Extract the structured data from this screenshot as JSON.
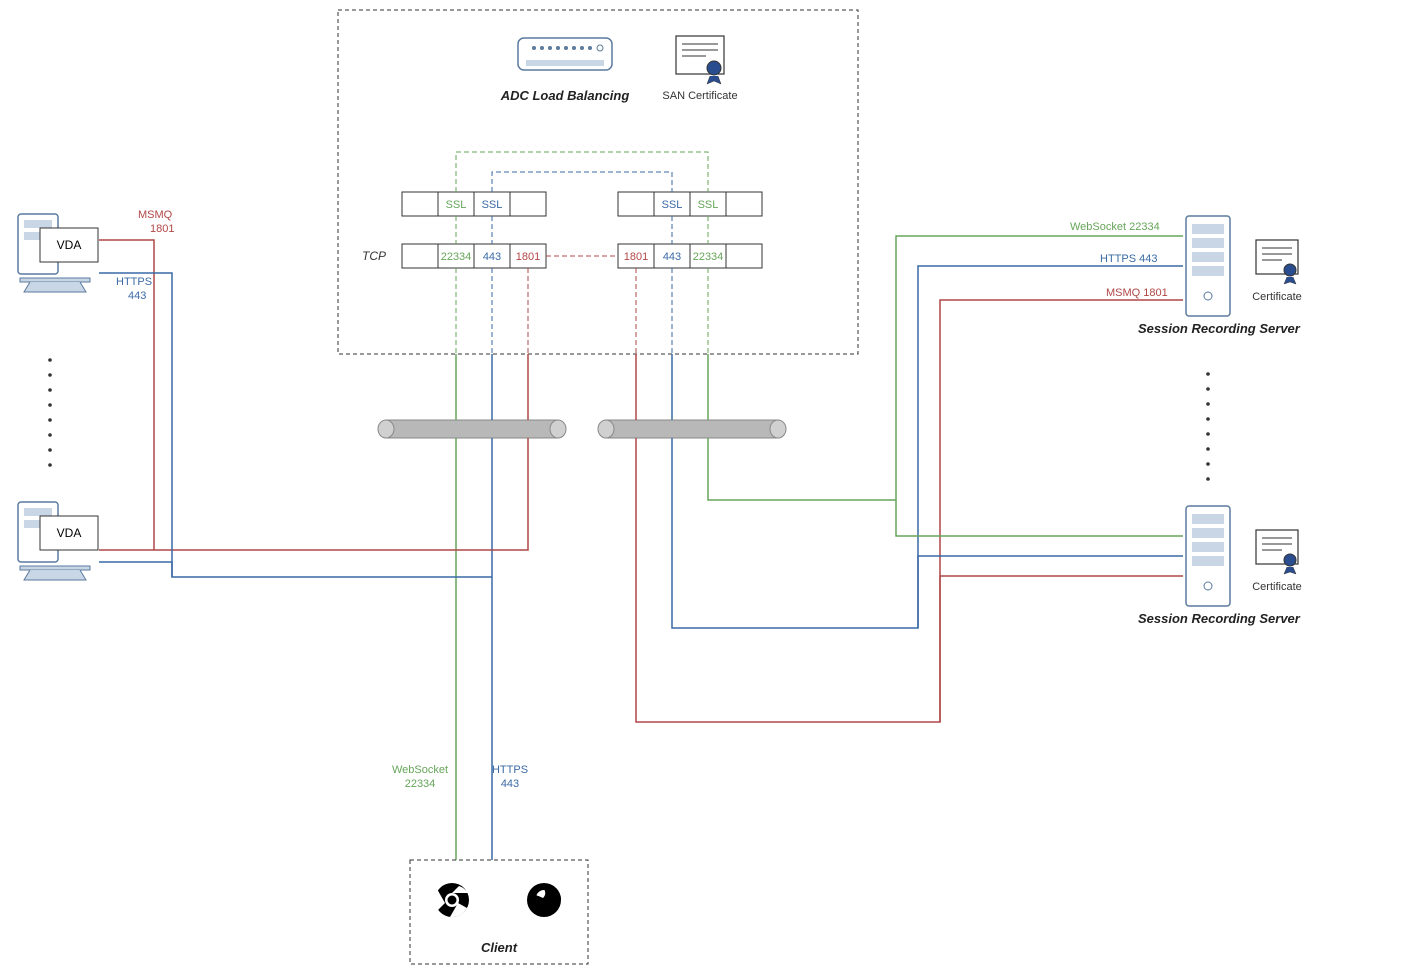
{
  "adc": {
    "title": "ADC Load Balancing",
    "san_cert": "SAN Certificate",
    "row1_label": "",
    "row2_label": "TCP",
    "boxes_row1": {
      "l": [
        "",
        "SSL",
        "SSL",
        ""
      ],
      "r": [
        "",
        "SSL",
        "SSL",
        ""
      ]
    },
    "boxes_row2": {
      "l": [
        "",
        "22334",
        "443",
        "1801"
      ],
      "r": [
        "1801",
        "443",
        "22334",
        ""
      ]
    }
  },
  "left": {
    "vda": "VDA",
    "msmq": "MSMQ",
    "msmq_port": "1801",
    "https": "HTTPS",
    "https_port": "443"
  },
  "right": {
    "ws": "WebSocket  22334",
    "https": "HTTPS  443",
    "msmq": "MSMQ  1801",
    "cert": "Certificate",
    "srs": "Session Recording Server"
  },
  "bottom": {
    "ws": "WebSocket",
    "ws_port": "22334",
    "https": "HTTPS",
    "https_port": "443",
    "client": "Client"
  }
}
